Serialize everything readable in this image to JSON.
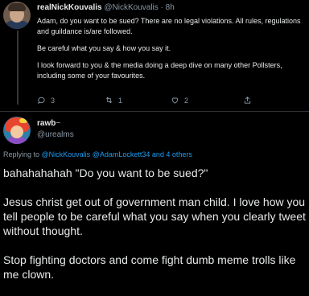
{
  "tweet1": {
    "display_name": "realNickKouvalis",
    "handle_time": "@NickKouvalis · 8h",
    "paragraphs": [
      "Adam, do you want to be sued? There are no legal violations. All rules, regulations and guildance is/are followed.",
      "Be careful what you say & how you say it.",
      "I look forward to you & the media doing a deep dive on many other Pollsters, including some of your favourites."
    ],
    "reply_count": "3",
    "retweet_count": "1",
    "like_count": "2",
    "icons": [
      "reply-icon",
      "retweet-icon",
      "heart-icon",
      "share-icon"
    ]
  },
  "tweet2": {
    "display_name": "rawb",
    "name_suffix": "~",
    "handle": "@urealms",
    "replying_prefix": "Replying to ",
    "replying_mentions": "@NickKouvalis @AdamLockett34",
    "replying_suffix": " and 4 others",
    "paragraphs": [
      "bahahahahah \"Do you want to be sued?\"",
      "Jesus christ get out of government man child. I love how you tell people to be careful what you say when you clearly tweet without thought.",
      "Stop fighting doctors and come fight dumb meme trolls like me clown."
    ]
  },
  "colors": {
    "background": "#000000",
    "text": "#e7e9ea",
    "secondary": "#8b98a5",
    "accent": "#1d9bf0"
  }
}
